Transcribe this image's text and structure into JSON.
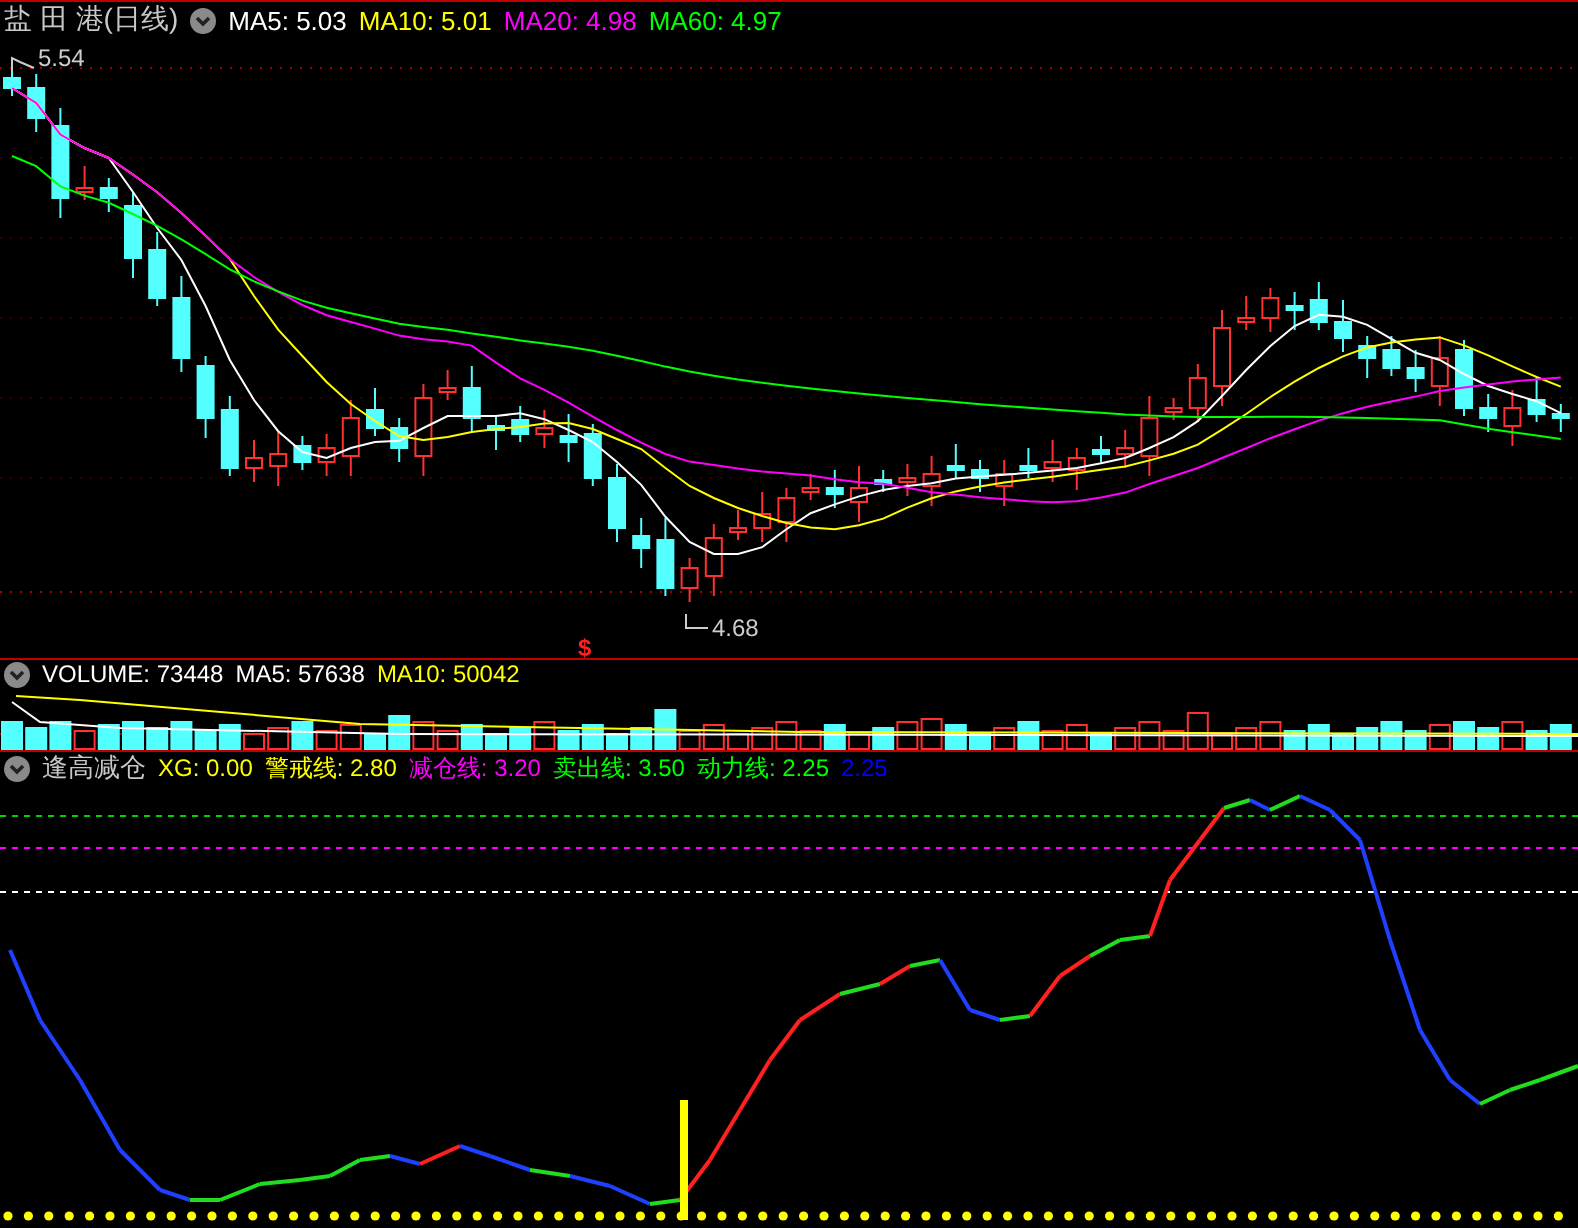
{
  "price_panel": {
    "title": "盐 田 港(日线)",
    "indicators": [
      {
        "label": "MA5: 5.03",
        "color": "#ffffff"
      },
      {
        "label": "MA10: 5.01",
        "color": "#ffff00"
      },
      {
        "label": "MA20: 4.98",
        "color": "#ff00ff"
      },
      {
        "label": "MA60: 4.97",
        "color": "#00ff00"
      }
    ],
    "high_label": "5.54",
    "low_label": "4.68",
    "signal_mark": "$"
  },
  "volume_panel": {
    "indicators": [
      {
        "label": "VOLUME: 73448",
        "color": "#ffffff"
      },
      {
        "label": "MA5: 57638",
        "color": "#ffffff"
      },
      {
        "label": "MA10: 50042",
        "color": "#ffff00"
      }
    ]
  },
  "indicator_panel": {
    "title": "逢高减仓",
    "indicators": [
      {
        "label": "XG: 0.00",
        "color": "#ffff00"
      },
      {
        "label": "警戒线: 2.80",
        "color": "#ffff00"
      },
      {
        "label": "减仓线: 3.20",
        "color": "#ff00ff"
      },
      {
        "label": "卖出线: 3.50",
        "color": "#00ff00"
      },
      {
        "label": "动力线: 2.25",
        "color": "#00ff00"
      },
      {
        "label": "2.25",
        "color": "#0000ff"
      }
    ]
  }
}
